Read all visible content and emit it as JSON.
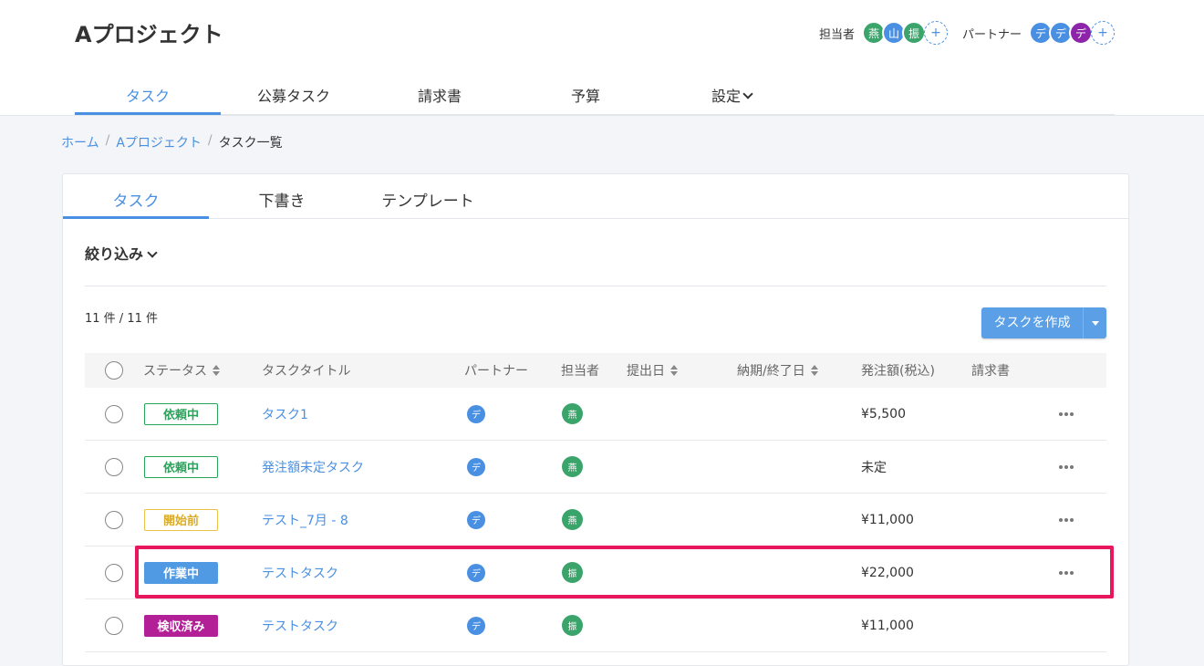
{
  "project": {
    "title": "Aプロジェクト"
  },
  "members": {
    "assignee_label": "担当者",
    "assignees": [
      {
        "initial": "燕",
        "color": "#3aa46b"
      },
      {
        "initial": "山",
        "color": "#4a90e2"
      },
      {
        "initial": "振",
        "color": "#3aa46b"
      }
    ],
    "partner_label": "パートナー",
    "partners": [
      {
        "initial": "デ",
        "color": "#4a90e2"
      },
      {
        "initial": "デ",
        "color": "#4a90e2"
      },
      {
        "initial": "デ",
        "color": "#8e24aa"
      }
    ],
    "add_symbol": "+"
  },
  "nav": {
    "items": [
      {
        "label": "タスク",
        "active": true
      },
      {
        "label": "公募タスク"
      },
      {
        "label": "請求書"
      },
      {
        "label": "予算"
      },
      {
        "label": "設定"
      }
    ]
  },
  "breadcrumb": {
    "items": [
      "ホーム",
      "Aプロジェクト"
    ],
    "current": "タスク一覧"
  },
  "tabs": [
    {
      "label": "タスク",
      "active": true
    },
    {
      "label": "下書き"
    },
    {
      "label": "テンプレート"
    }
  ],
  "filter": {
    "label": "絞り込み"
  },
  "count": {
    "text": "11 件 / 11 件"
  },
  "create_button": {
    "label": "タスクを作成"
  },
  "table": {
    "headers": {
      "status": "ステータス",
      "title": "タスクタイトル",
      "partner": "パートナー",
      "assignee": "担当者",
      "submit_date": "提出日",
      "due_date": "納期/終了日",
      "amount": "発注額(税込)",
      "invoice": "請求書"
    },
    "rows": [
      {
        "status": "依頼中",
        "status_style": "green",
        "title": "タスク1",
        "partner": "デ",
        "partner_color": "#4a90e2",
        "assignee": "燕",
        "assignee_color": "#3aa46b",
        "amount": "¥5,500",
        "has_menu": true
      },
      {
        "status": "依頼中",
        "status_style": "green",
        "title": "発注額未定タスク",
        "partner": "デ",
        "partner_color": "#4a90e2",
        "assignee": "燕",
        "assignee_color": "#3aa46b",
        "amount": "未定",
        "has_menu": true
      },
      {
        "status": "開始前",
        "status_style": "yellow",
        "title": "テスト_7月 - 8",
        "partner": "デ",
        "partner_color": "#4a90e2",
        "assignee": "燕",
        "assignee_color": "#3aa46b",
        "amount": "¥11,000",
        "has_menu": true
      },
      {
        "status": "作業中",
        "status_style": "blue",
        "title": "テストタスク",
        "partner": "デ",
        "partner_color": "#4a90e2",
        "assignee": "振",
        "assignee_color": "#3aa46b",
        "amount": "¥22,000",
        "has_menu": true
      },
      {
        "status": "検収済み",
        "status_style": "purple",
        "title": "テストタスク",
        "partner": "デ",
        "partner_color": "#4a90e2",
        "assignee": "振",
        "assignee_color": "#3aa46b",
        "amount": "¥11,000",
        "has_menu": false
      }
    ]
  },
  "colors": {
    "accent": "#4a90e2",
    "highlight": "#e8175d"
  }
}
